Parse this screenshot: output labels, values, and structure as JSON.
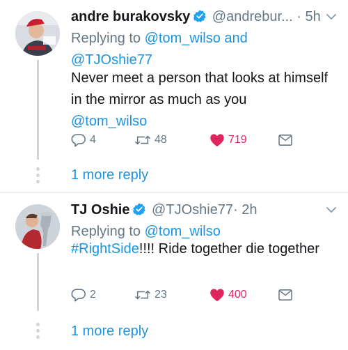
{
  "tweets": [
    {
      "name": "andre burakovsky",
      "handle": "@andrebur...",
      "separator": "·",
      "time": "5h",
      "replying_prefix": "Replying to",
      "replying_to_1": "@tom_wilso",
      "replying_joiner": "and",
      "replying_to_2": "@TJOshie77",
      "body": "Never meet a person that looks at himself in the mirror as much as you",
      "body_mention": "@tom_wilso",
      "reply_count": "4",
      "retweet_count": "48",
      "like_count": "719",
      "more_replies": "1 more reply"
    },
    {
      "name": "TJ Oshie",
      "handle": "@TJOshie77",
      "separator": "·",
      "time": "2h",
      "replying_prefix": "Replying to",
      "replying_to_1": "@tom_wilso",
      "body_hashtag": "#RightSide",
      "body": "!!!! Ride together die together",
      "reply_count": "2",
      "retweet_count": "23",
      "like_count": "400",
      "more_replies": "1 more reply"
    }
  ],
  "colors": {
    "link": "#1b95e0",
    "secondary": "#657786",
    "like": "#e0245e",
    "verified": "#1da1f2",
    "thread_line": "#ccd6dd"
  },
  "icons": [
    "verified-badge-icon",
    "chevron-down-icon",
    "reply-icon",
    "retweet-icon",
    "like-heart-icon",
    "direct-message-icon"
  ]
}
